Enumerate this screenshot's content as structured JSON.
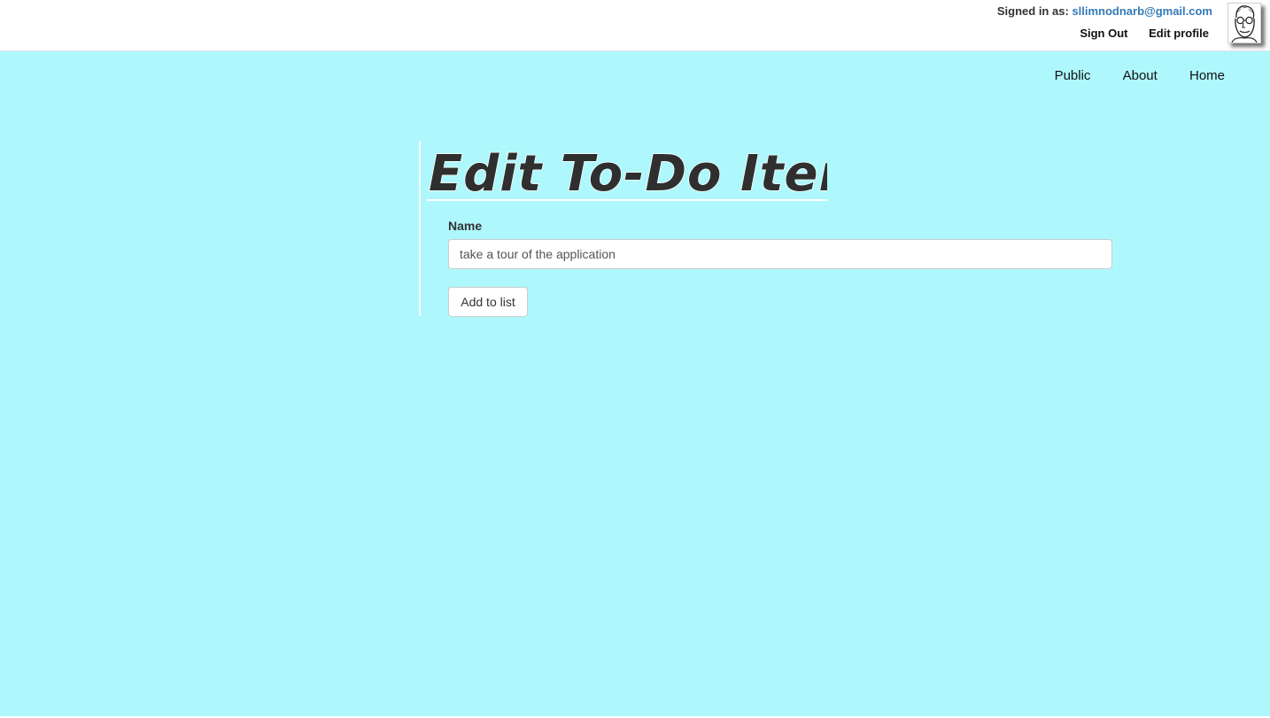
{
  "header": {
    "signed_in_label": "Signed in as:",
    "user_email": "sllimnodnarb@gmail.com",
    "sign_out_label": "Sign Out",
    "edit_profile_label": "Edit profile",
    "avatar_icon": "user-portrait-sketch"
  },
  "nav": {
    "items": [
      {
        "label": "Public"
      },
      {
        "label": "About"
      },
      {
        "label": "Home"
      }
    ]
  },
  "form": {
    "title": "Edit To-Do Item",
    "name_label": "Name",
    "name_value": "take a tour of the application",
    "submit_label": "Add to list"
  },
  "colors": {
    "background": "#aef8fd",
    "link": "#337ab7",
    "title_text": "#2f2f2f"
  }
}
